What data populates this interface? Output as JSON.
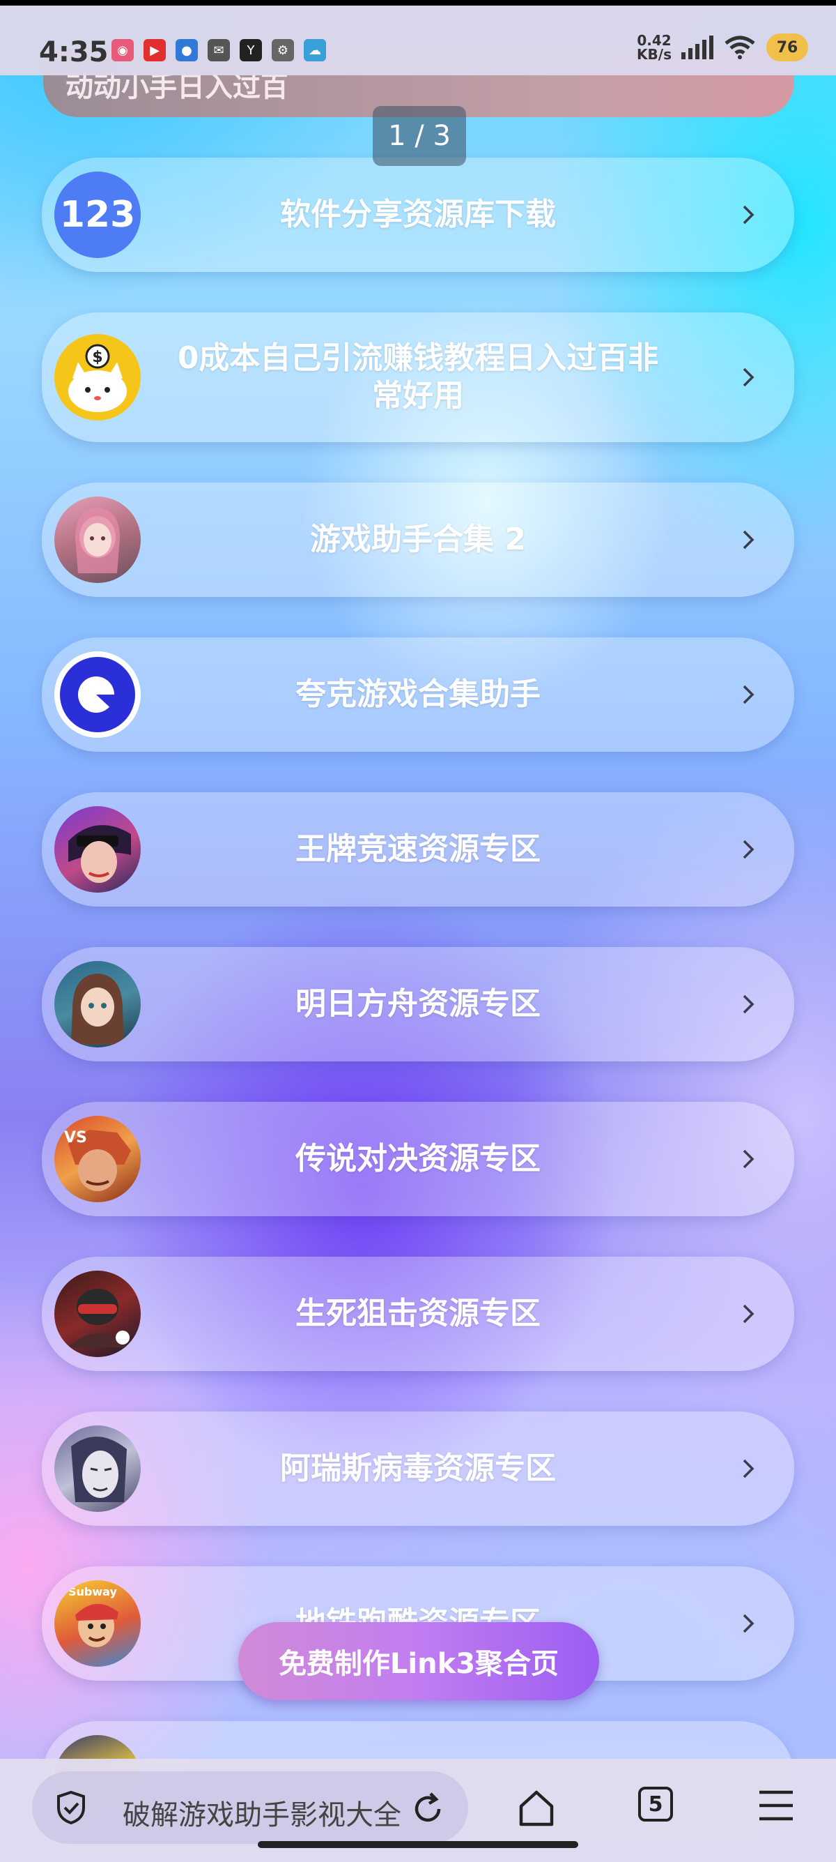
{
  "status_bar": {
    "time": "4:35",
    "net_speed_value": "0.42",
    "net_speed_unit": "KB/s",
    "battery": "76"
  },
  "header": {
    "top_card_text": "动动小手日入过百",
    "page_indicator": "1 / 3"
  },
  "links": [
    {
      "title": "软件分享资源库下载"
    },
    {
      "title": "0成本自己引流赚钱教程日入过百非常好用"
    },
    {
      "title": "游戏助手合集 2"
    },
    {
      "title": "夸克游戏合集助手"
    },
    {
      "title": "王牌竞速资源专区"
    },
    {
      "title": "明日方舟资源专区"
    },
    {
      "title": "传说对决资源专区"
    },
    {
      "title": "生死狙击资源专区"
    },
    {
      "title": "阿瑞斯病毒资源专区"
    },
    {
      "title": "地铁跑酷资源专区"
    }
  ],
  "avatar_badges": {
    "first": "123",
    "subway": "Subway"
  },
  "cta": {
    "label": "免费制作Link3聚合页"
  },
  "browser": {
    "address_text": "破解游戏助手影视大全",
    "tab_count": "5"
  }
}
